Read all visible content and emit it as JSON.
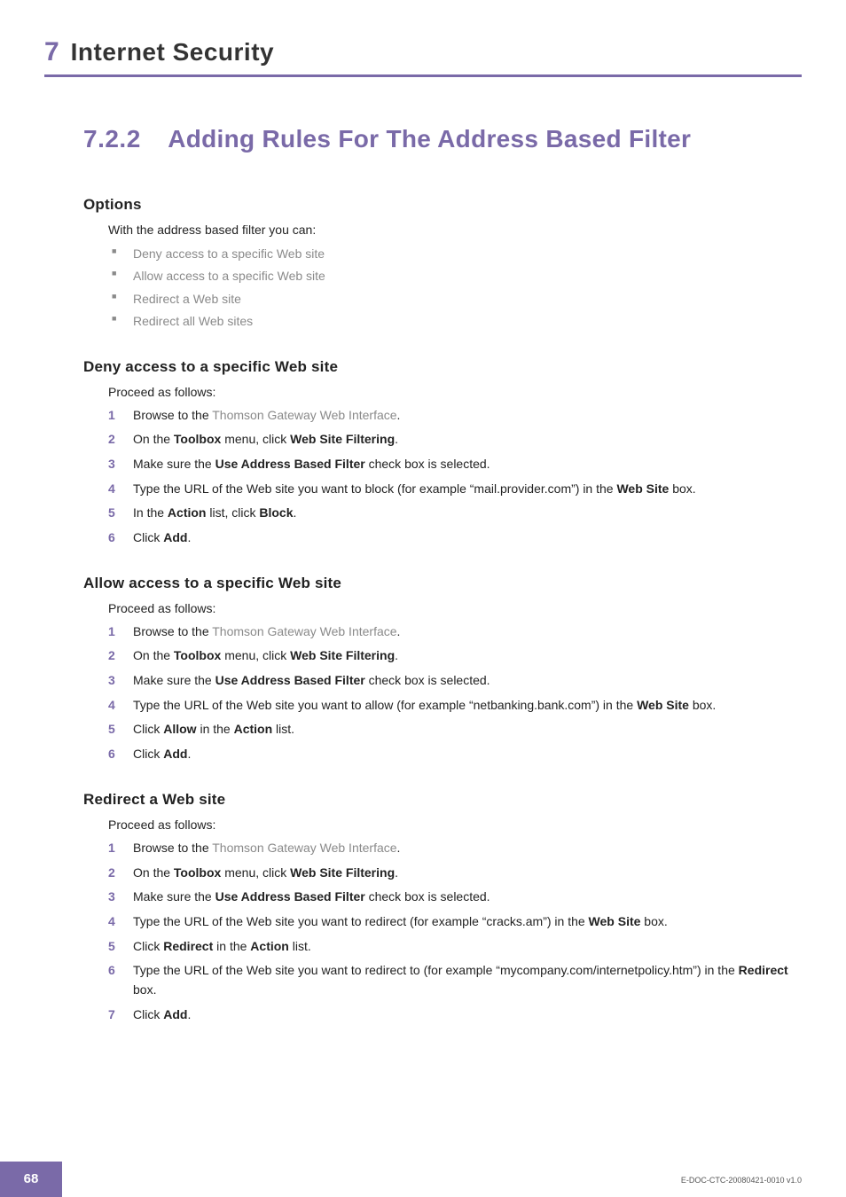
{
  "chapter": {
    "number": "7",
    "title": "Internet Security"
  },
  "section": {
    "number": "7.2.2",
    "title": "Adding Rules For The Address Based Filter"
  },
  "options": {
    "heading": "Options",
    "intro": "With the address based filter you can:",
    "items": [
      "Deny access to a specific Web site",
      "Allow access to a specific Web site",
      "Redirect a Web site",
      "Redirect all Web sites"
    ]
  },
  "deny": {
    "heading": "Deny access to a specific Web site",
    "intro": "Proceed as follows:",
    "steps": {
      "s1a": "Browse to the ",
      "s1link": "Thomson Gateway Web Interface",
      "s1b": ".",
      "s2a": "On the ",
      "s2b": "Toolbox",
      "s2c": " menu, click ",
      "s2d": "Web Site Filtering",
      "s2e": ".",
      "s3a": "Make sure the ",
      "s3b": "Use Address Based Filter",
      "s3c": " check box is selected.",
      "s4a": "Type the URL of the Web site you want to block (for example “mail.provider.com”) in the ",
      "s4b": "Web Site",
      "s4c": " box.",
      "s5a": "In the ",
      "s5b": "Action",
      "s5c": " list, click ",
      "s5d": "Block",
      "s5e": ".",
      "s6a": "Click ",
      "s6b": "Add",
      "s6c": "."
    }
  },
  "allow": {
    "heading": "Allow access to a specific Web site",
    "intro": "Proceed as follows:",
    "steps": {
      "s1a": "Browse to the ",
      "s1link": "Thomson Gateway Web Interface",
      "s1b": ".",
      "s2a": "On the ",
      "s2b": "Toolbox",
      "s2c": " menu, click ",
      "s2d": "Web Site Filtering",
      "s2e": ".",
      "s3a": "Make sure the ",
      "s3b": "Use Address Based Filter",
      "s3c": " check box is selected.",
      "s4a": "Type the URL of the Web site you want to allow (for example “netbanking.bank.com”) in the ",
      "s4b": "Web Site",
      "s4c": " box.",
      "s5a": "Click ",
      "s5b": "Allow",
      "s5c": " in the ",
      "s5d": "Action",
      "s5e": " list.",
      "s6a": "Click ",
      "s6b": "Add",
      "s6c": "."
    }
  },
  "redirect": {
    "heading": "Redirect a Web site",
    "intro": "Proceed as follows:",
    "steps": {
      "s1a": "Browse to the ",
      "s1link": "Thomson Gateway Web Interface",
      "s1b": ".",
      "s2a": "On the ",
      "s2b": "Toolbox",
      "s2c": " menu, click ",
      "s2d": "Web Site Filtering",
      "s2e": ".",
      "s3a": "Make sure the ",
      "s3b": "Use Address Based Filter",
      "s3c": " check box is selected.",
      "s4a": "Type the URL of the Web site you want to redirect (for example “cracks.am”) in the ",
      "s4b": "Web Site",
      "s4c": " box.",
      "s5a": "Click ",
      "s5b": "Redirect",
      "s5c": " in the ",
      "s5d": "Action",
      "s5e": " list.",
      "s6a": "Type the URL of the Web site you want to redirect to (for example “mycompany.com/internetpolicy.htm”) in the ",
      "s6b": "Redirect",
      "s6c": " box.",
      "s7a": "Click ",
      "s7b": "Add",
      "s7c": "."
    }
  },
  "footer": {
    "page": "68",
    "docid": "E-DOC-CTC-20080421-0010 v1.0"
  },
  "numbers": {
    "n1": "1",
    "n2": "2",
    "n3": "3",
    "n4": "4",
    "n5": "5",
    "n6": "6",
    "n7": "7"
  }
}
